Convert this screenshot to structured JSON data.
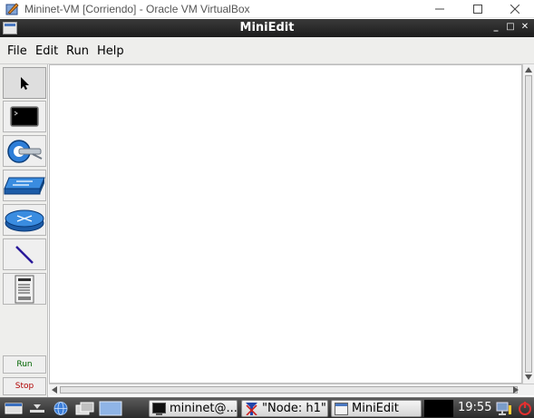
{
  "host_window": {
    "title": "Mininet-VM [Corriendo] - Oracle VM VirtualBox",
    "icons": [
      "virtualbox-icon",
      "minimize-icon",
      "maximize-icon",
      "close-icon"
    ]
  },
  "app_window": {
    "title": "MiniEdit",
    "buttons": {
      "minimize": "_",
      "maximize": "□",
      "close": "✕"
    }
  },
  "menu": {
    "items": [
      {
        "label": "File"
      },
      {
        "label": "Edit"
      },
      {
        "label": "Run"
      },
      {
        "label": "Help"
      }
    ]
  },
  "toolbar": {
    "tools": [
      {
        "name": "select-tool",
        "icon": "pointer-arrow-icon",
        "selected": true
      },
      {
        "name": "host-tool",
        "icon": "terminal-host-icon"
      },
      {
        "name": "controller-tool",
        "icon": "controller-icon"
      },
      {
        "name": "switch-tool",
        "icon": "switch-icon"
      },
      {
        "name": "router-tool",
        "icon": "router-icon"
      },
      {
        "name": "netlink-tool",
        "icon": "netlink-line-icon"
      },
      {
        "name": "legacy-switch-tool",
        "icon": "server-icon"
      }
    ],
    "run_label": "Run",
    "stop_label": "Stop",
    "colors": {
      "run": "#006400",
      "stop": "#b00000"
    }
  },
  "taskbar": {
    "launcher_icons": [
      "menu-icon",
      "minimize-all-icon",
      "browser-globe-icon",
      "file-manager-icon",
      "desktop-icon"
    ],
    "tasks": [
      {
        "label": "mininet@...",
        "icon": "terminal-icon"
      },
      {
        "label": "\"Node: h1\"",
        "icon": "x-terminal-icon"
      },
      {
        "label": "MiniEdit",
        "icon": "window-icon"
      }
    ],
    "clock": "19:55",
    "tray_icons": [
      "network-icon",
      "power-icon"
    ]
  }
}
